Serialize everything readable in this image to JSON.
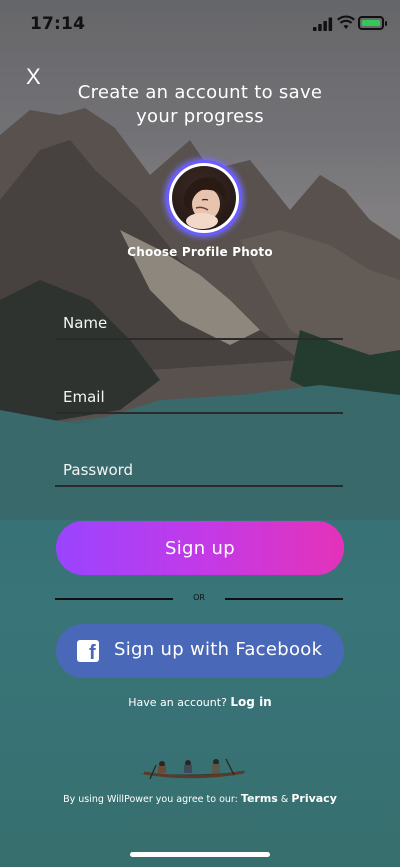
{
  "status_bar": {
    "time": "17:14"
  },
  "header": {
    "close_label": "X",
    "title": "Create an account to save your progress"
  },
  "profile": {
    "choose_label": "Choose Profile Photo"
  },
  "form": {
    "name_placeholder": "Name",
    "email_placeholder": "Email",
    "password_placeholder": "Password"
  },
  "buttons": {
    "signup_label": "Sign up",
    "or_label": "OR",
    "facebook_label": "Sign up with Facebook"
  },
  "login": {
    "prompt": "Have an account?",
    "link_label": "Log in"
  },
  "legal": {
    "prefix": "By using WillPower you agree to our:",
    "terms_label": "Terms",
    "ampersand": "&",
    "privacy_label": "Privacy"
  },
  "colors": {
    "signup_gradient_start": "#9a44ff",
    "signup_gradient_end": "#e432b9",
    "facebook_blue": "#4a68b8",
    "battery_green": "#35c759"
  }
}
